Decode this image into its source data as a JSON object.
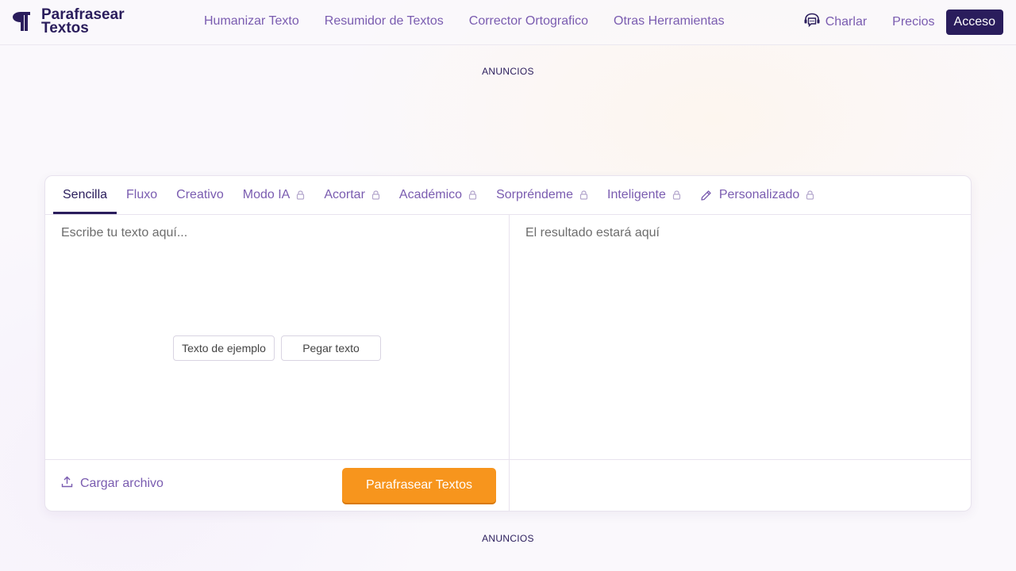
{
  "header": {
    "logo_line1": "Parafrasear",
    "logo_line2": "Textos",
    "nav": [
      "Humanizar Texto",
      "Resumidor de Textos",
      "Corrector Ortografico",
      "Otras Herramientas"
    ],
    "chat_label": "Charlar",
    "pricing_label": "Precios",
    "login_label": "Acceso"
  },
  "ads": {
    "top_label": "ANUNCIOS",
    "bottom_label": "ANUNCIOS"
  },
  "tool": {
    "tabs": [
      {
        "label": "Sencilla",
        "locked": false,
        "active": true
      },
      {
        "label": "Fluxo",
        "locked": false
      },
      {
        "label": "Creativo",
        "locked": false
      },
      {
        "label": "Modo IA",
        "locked": true
      },
      {
        "label": "Acortar",
        "locked": true
      },
      {
        "label": "Académico",
        "locked": true
      },
      {
        "label": "Sorpréndeme",
        "locked": true
      },
      {
        "label": "Inteligente",
        "locked": true
      },
      {
        "label": "Personalizado",
        "locked": true,
        "icon": "pencil-icon"
      }
    ],
    "input_placeholder": "Escribe tu texto aquí...",
    "output_placeholder": "El resultado estará aquí",
    "sample_button": "Texto de ejemplo",
    "paste_button": "Pegar texto",
    "upload_label": "Cargar archivo",
    "submit_label": "Parafrasear Textos"
  },
  "colors": {
    "brand_dark": "#2a1d5c",
    "link_purple": "#7a5cb0",
    "cta_orange": "#f7951d"
  }
}
